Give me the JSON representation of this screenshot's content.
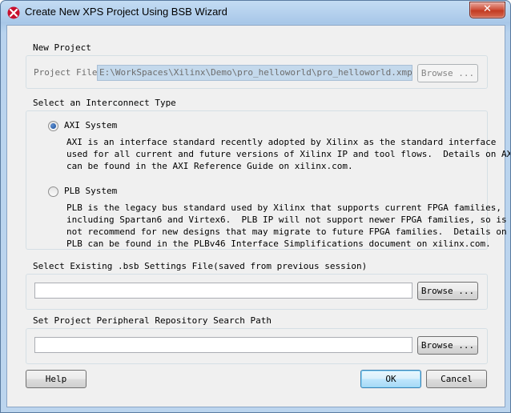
{
  "window": {
    "title": "Create New XPS Project Using BSB Wizard",
    "close_glyph": "✕"
  },
  "new_project": {
    "group_label": "New Project",
    "project_file_label": "Project File",
    "project_file_value": "E:\\WorkSpaces\\Xilinx\\Demo\\pro_helloworld\\pro_helloworld.xmp",
    "browse_label": "Browse ..."
  },
  "interconnect": {
    "group_label": "Select an Interconnect Type",
    "axi": {
      "label": "AXI System",
      "selected": true,
      "description": "AXI is an interface standard recently adopted by Xilinx as the standard interface\nused for all current and future versions of Xilinx IP and tool flows.  Details on AXI\ncan be found in the AXI Reference Guide on xilinx.com."
    },
    "plb": {
      "label": "PLB System",
      "selected": false,
      "description": "PLB is the legacy bus standard used by Xilinx that supports current FPGA families,\nincluding Spartan6 and Virtex6.  PLB IP will not support newer FPGA families, so is\nnot recommend for new designs that may migrate to future FPGA families.  Details on\nPLB can be found in the PLBv46 Interface Simplifications document on xilinx.com."
    }
  },
  "bsb_settings": {
    "group_label": "Select Existing .bsb Settings File(saved from previous session)",
    "value": "",
    "browse_label": "Browse ..."
  },
  "repository": {
    "group_label": "Set Project Peripheral Repository Search Path",
    "value": "",
    "browse_label": "Browse ..."
  },
  "footer": {
    "help_label": "Help",
    "ok_label": "OK",
    "cancel_label": "Cancel"
  }
}
